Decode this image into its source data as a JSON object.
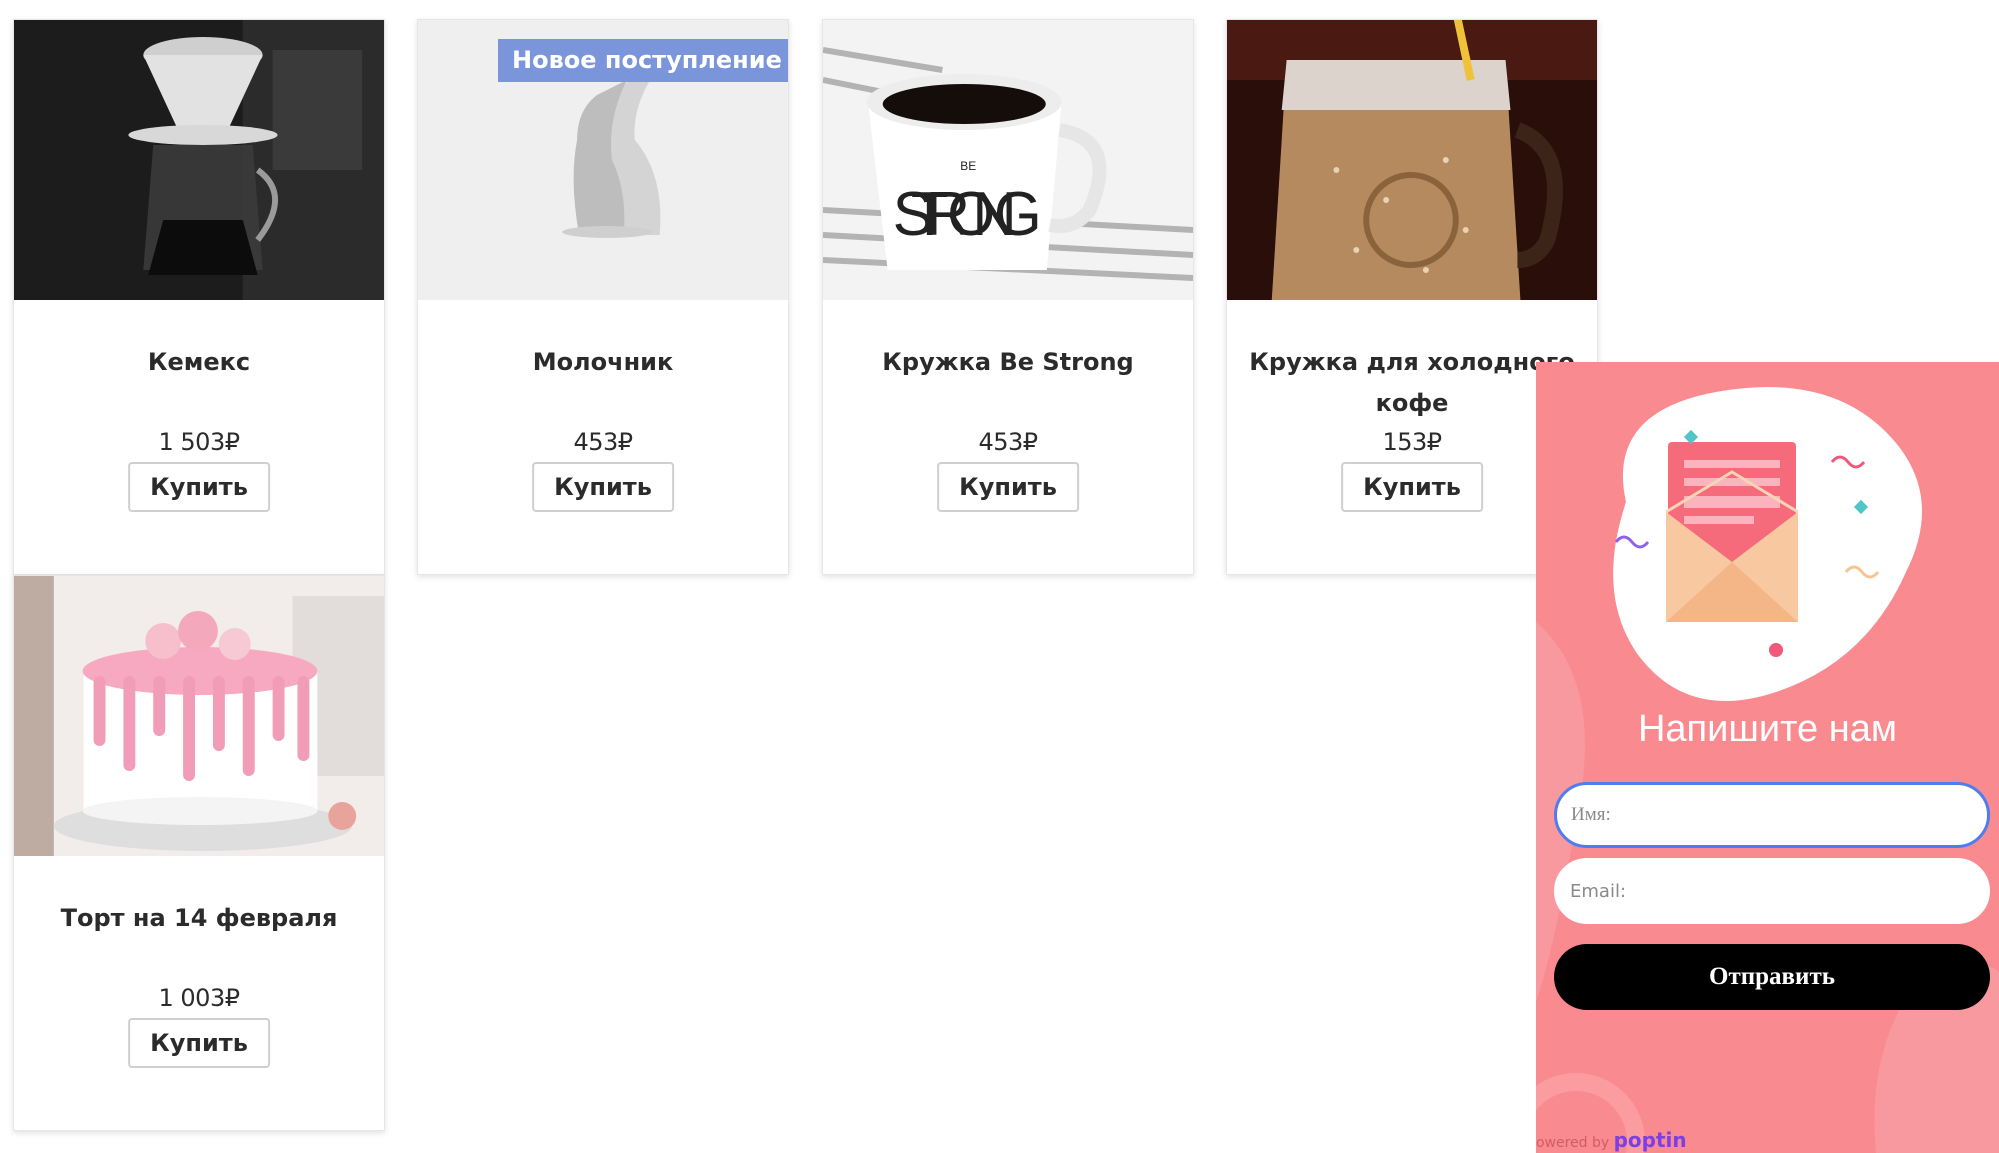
{
  "colors": {
    "badge": "#7a95d9",
    "popup_bg": "#f98a90",
    "send_button": "#000000",
    "input_focus": "#4f7df0"
  },
  "products": [
    {
      "title": "Кемекс",
      "price": "1 503₽",
      "buy_label": "Купить",
      "image": "chemex-coffee-maker"
    },
    {
      "title": "Молочник",
      "price": "453₽",
      "buy_label": "Купить",
      "image": "milk-jug",
      "badge": "Новое поступление"
    },
    {
      "title": "Кружка Be Strong",
      "price": "453₽",
      "buy_label": "Купить",
      "image": "be-strong-mug"
    },
    {
      "title": "Кружка для холодного кофе",
      "price": "153₽",
      "buy_label": "Купить",
      "image": "cold-coffee-jar"
    },
    {
      "title": "Торт на 14 февраля",
      "price": "1 003₽",
      "buy_label": "Купить",
      "image": "valentine-cake"
    }
  ],
  "popup": {
    "title": "Напишите нам",
    "name_placeholder": "Имя:",
    "email_placeholder": "Email:",
    "submit_label": "Отправить",
    "powered_prefix": "Powered by",
    "powered_brand": "poptin",
    "illustration": "envelope-icon"
  }
}
